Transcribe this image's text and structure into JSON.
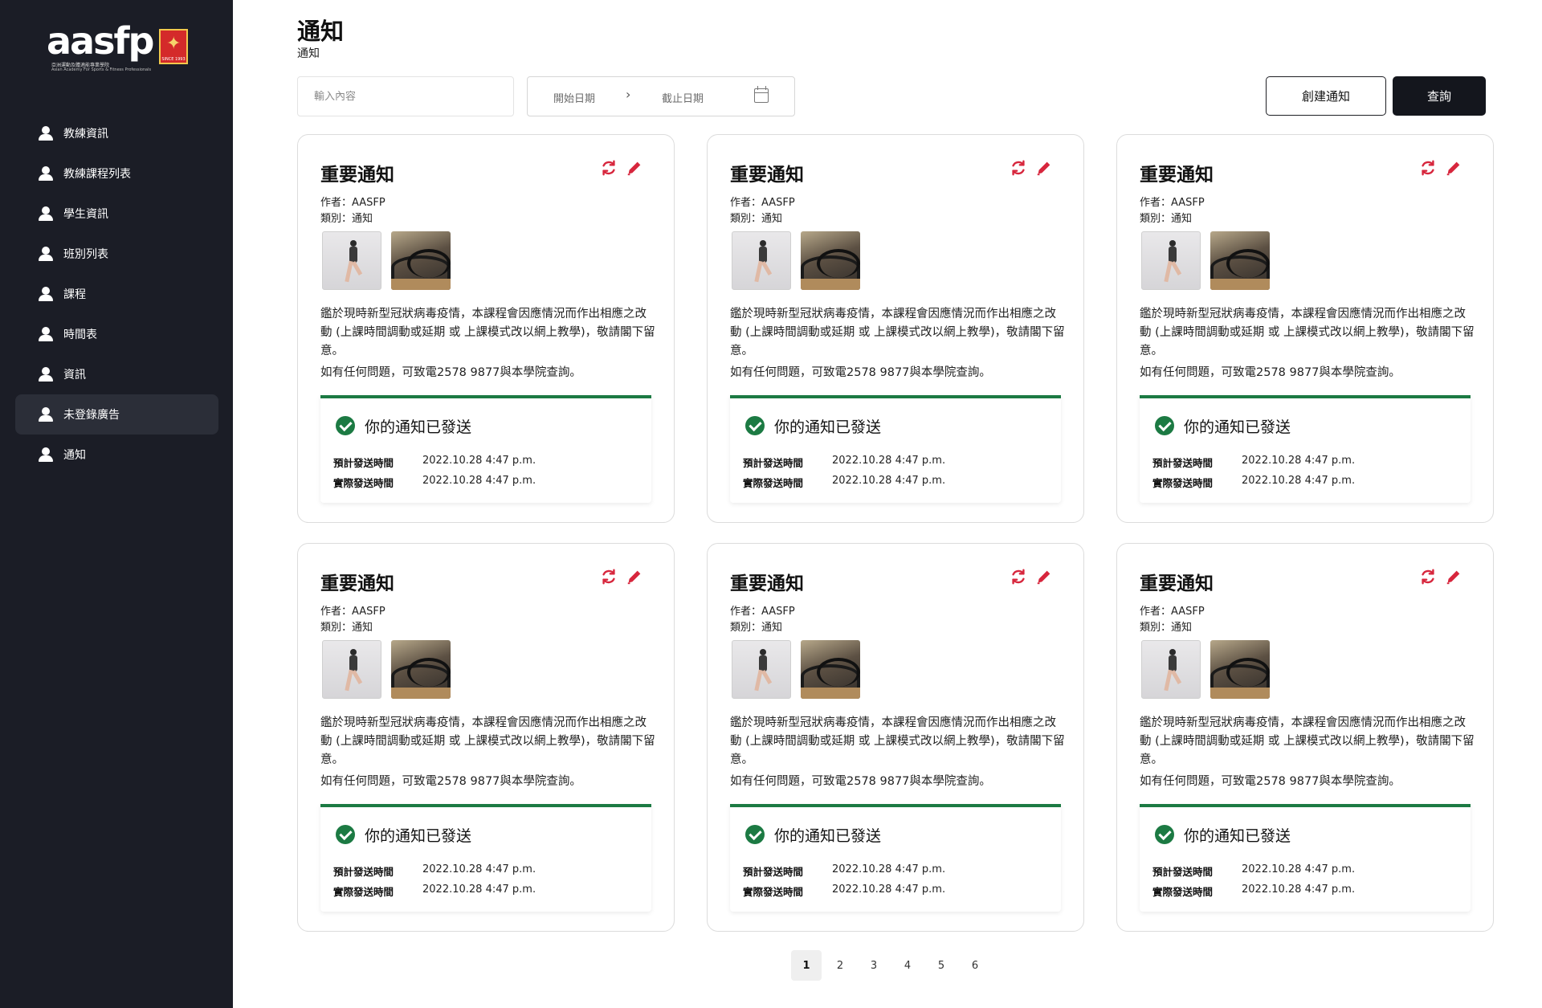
{
  "logo": {
    "word": "aasfp",
    "since": "SINCE 1993",
    "tagline_zh": "亞洲運動及體適能專業學院",
    "tagline_en": "Asian Academy For Sports & Fitness Professionals"
  },
  "sidebar": {
    "items": [
      {
        "label": "教練資訊",
        "icon": "user-icon",
        "active": false
      },
      {
        "label": "教練課程列表",
        "icon": "user-icon",
        "active": false
      },
      {
        "label": "學生資訊",
        "icon": "user-icon",
        "active": false
      },
      {
        "label": "班別列表",
        "icon": "user-icon",
        "active": false
      },
      {
        "label": "課程",
        "icon": "user-icon",
        "active": false
      },
      {
        "label": "時間表",
        "icon": "user-icon",
        "active": false
      },
      {
        "label": "資訊",
        "icon": "user-icon",
        "active": false
      },
      {
        "label": "未登錄廣告",
        "icon": "user-icon",
        "active": true
      },
      {
        "label": "通知",
        "icon": "user-icon",
        "active": false
      }
    ]
  },
  "header": {
    "title": "通知",
    "subtitle": "通知"
  },
  "filters": {
    "search_placeholder": "輸入內容",
    "date_start": "開始日期",
    "date_separator": "›",
    "date_end": "截止日期"
  },
  "actions": {
    "create_label": "創建通知",
    "query_label": "查詢"
  },
  "colors": {
    "sidebar_bg": "#1b1d26",
    "accent_red": "#d7263d",
    "success_green": "#1c7a43",
    "primary_dark": "#14161d"
  },
  "cards": [
    {
      "title": "重要通知",
      "author": "作者：AASFP",
      "category": "類別：通知",
      "body": "鑑於現時新型冠狀病毒疫情，本課程會因應情況而作出相應之改動 (上課時間調動或延期 或 上課模式改以網上教學)，敬請閣下留意。",
      "contact": "如有任何問題，可致電2578 9877與本學院查詢。",
      "status": "你的通知已發送",
      "sched_label": "預計發送時間",
      "sched_value": "2022.10.28 4:47 p.m.",
      "actual_label": "實際發送時間",
      "actual_value": "2022.10.28 4:47 p.m."
    },
    {
      "title": "重要通知",
      "author": "作者：AASFP",
      "category": "類別：通知",
      "body": "鑑於現時新型冠狀病毒疫情，本課程會因應情況而作出相應之改動 (上課時間調動或延期 或 上課模式改以網上教學)，敬請閣下留意。",
      "contact": "如有任何問題，可致電2578 9877與本學院查詢。",
      "status": "你的通知已發送",
      "sched_label": "預計發送時間",
      "sched_value": "2022.10.28 4:47 p.m.",
      "actual_label": "實際發送時間",
      "actual_value": "2022.10.28 4:47 p.m."
    },
    {
      "title": "重要通知",
      "author": "作者：AASFP",
      "category": "類別：通知",
      "body": "鑑於現時新型冠狀病毒疫情，本課程會因應情況而作出相應之改動 (上課時間調動或延期 或 上課模式改以網上教學)，敬請閣下留意。",
      "contact": "如有任何問題，可致電2578 9877與本學院查詢。",
      "status": "你的通知已發送",
      "sched_label": "預計發送時間",
      "sched_value": "2022.10.28 4:47 p.m.",
      "actual_label": "實際發送時間",
      "actual_value": "2022.10.28 4:47 p.m."
    },
    {
      "title": "重要通知",
      "author": "作者：AASFP",
      "category": "類別：通知",
      "body": "鑑於現時新型冠狀病毒疫情，本課程會因應情況而作出相應之改動 (上課時間調動或延期 或 上課模式改以網上教學)，敬請閣下留意。",
      "contact": "如有任何問題，可致電2578 9877與本學院查詢。",
      "status": "你的通知已發送",
      "sched_label": "預計發送時間",
      "sched_value": "2022.10.28 4:47 p.m.",
      "actual_label": "實際發送時間",
      "actual_value": "2022.10.28 4:47 p.m."
    },
    {
      "title": "重要通知",
      "author": "作者：AASFP",
      "category": "類別：通知",
      "body": "鑑於現時新型冠狀病毒疫情，本課程會因應情況而作出相應之改動 (上課時間調動或延期 或 上課模式改以網上教學)，敬請閣下留意。",
      "contact": "如有任何問題，可致電2578 9877與本學院查詢。",
      "status": "你的通知已發送",
      "sched_label": "預計發送時間",
      "sched_value": "2022.10.28 4:47 p.m.",
      "actual_label": "實際發送時間",
      "actual_value": "2022.10.28 4:47 p.m."
    },
    {
      "title": "重要通知",
      "author": "作者：AASFP",
      "category": "類別：通知",
      "body": "鑑於現時新型冠狀病毒疫情，本課程會因應情況而作出相應之改動 (上課時間調動或延期 或 上課模式改以網上教學)，敬請閣下留意。",
      "contact": "如有任何問題，可致電2578 9877與本學院查詢。",
      "status": "你的通知已發送",
      "sched_label": "預計發送時間",
      "sched_value": "2022.10.28 4:47 p.m.",
      "actual_label": "實際發送時間",
      "actual_value": "2022.10.28 4:47 p.m."
    }
  ],
  "pagination": {
    "pages": [
      "1",
      "2",
      "3",
      "4",
      "5",
      "6"
    ],
    "current": "1"
  }
}
